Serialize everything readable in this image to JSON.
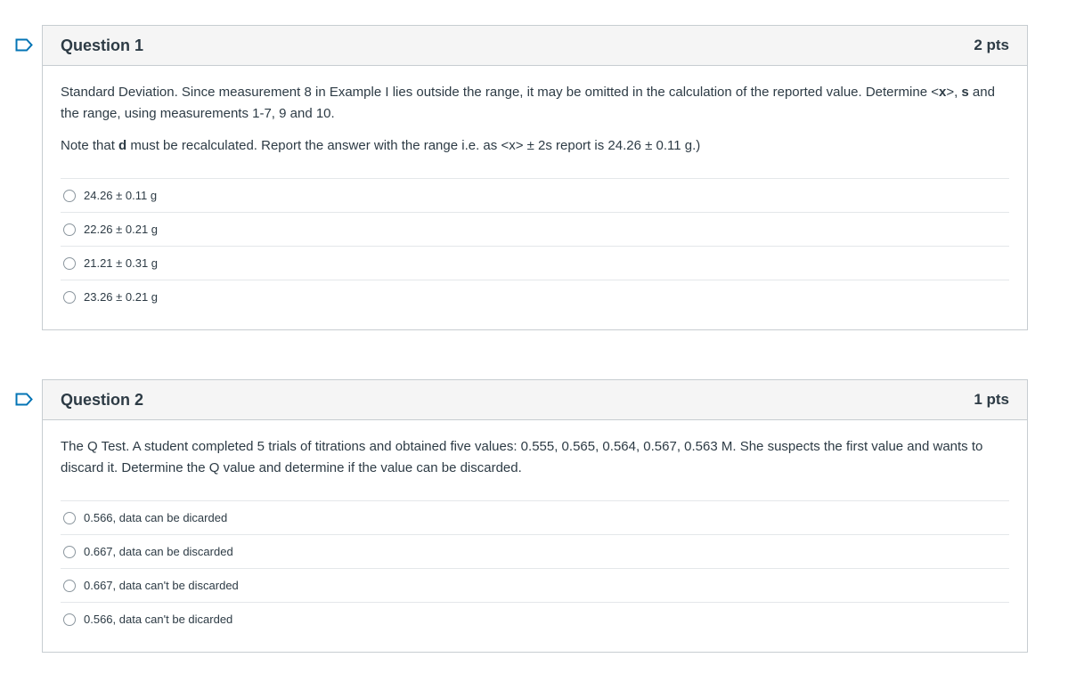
{
  "questions": [
    {
      "title": "Question 1",
      "points": "2 pts",
      "text1_a": "Standard Deviation. Since measurement 8 in Example I lies outside the range, it may be omitted in the calculation of the reported value. Determine <",
      "text1_b": "x",
      "text1_c": ">, ",
      "text1_d": "s",
      "text1_e": " and the range, using measurements 1-7, 9 and 10.",
      "text2_a": "Note that ",
      "text2_b": "d",
      "text2_c": " must be recalculated. Report the answer with the range i.e. as <x> ± 2s  report is 24.26 ± 0.11 g.)",
      "answers": [
        "24.26 ± 0.11 g",
        "22.26 ± 0.21 g",
        "21.21 ± 0.31 g",
        "23.26 ± 0.21 g"
      ]
    },
    {
      "title": "Question 2",
      "points": "1 pts",
      "text1": "The Q Test. A student completed 5 trials of titrations and obtained five values:  0.555, 0.565, 0.564, 0.567, 0.563 M. She suspects the first value and wants to discard it. Determine the Q value and determine if the value can be discarded.",
      "answers": [
        "0.566, data can be dicarded",
        "0.667, data can be discarded",
        "0.667, data can't be discarded",
        "0.566, data can't be dicarded"
      ]
    }
  ],
  "colors": {
    "text": "#2d3b45",
    "border": "#c7cdd1",
    "header_bg": "#f5f5f5",
    "bookmark": "#0374b5"
  },
  "icons": {
    "bookmark": "bookmark-icon",
    "radio": "radio-button"
  }
}
